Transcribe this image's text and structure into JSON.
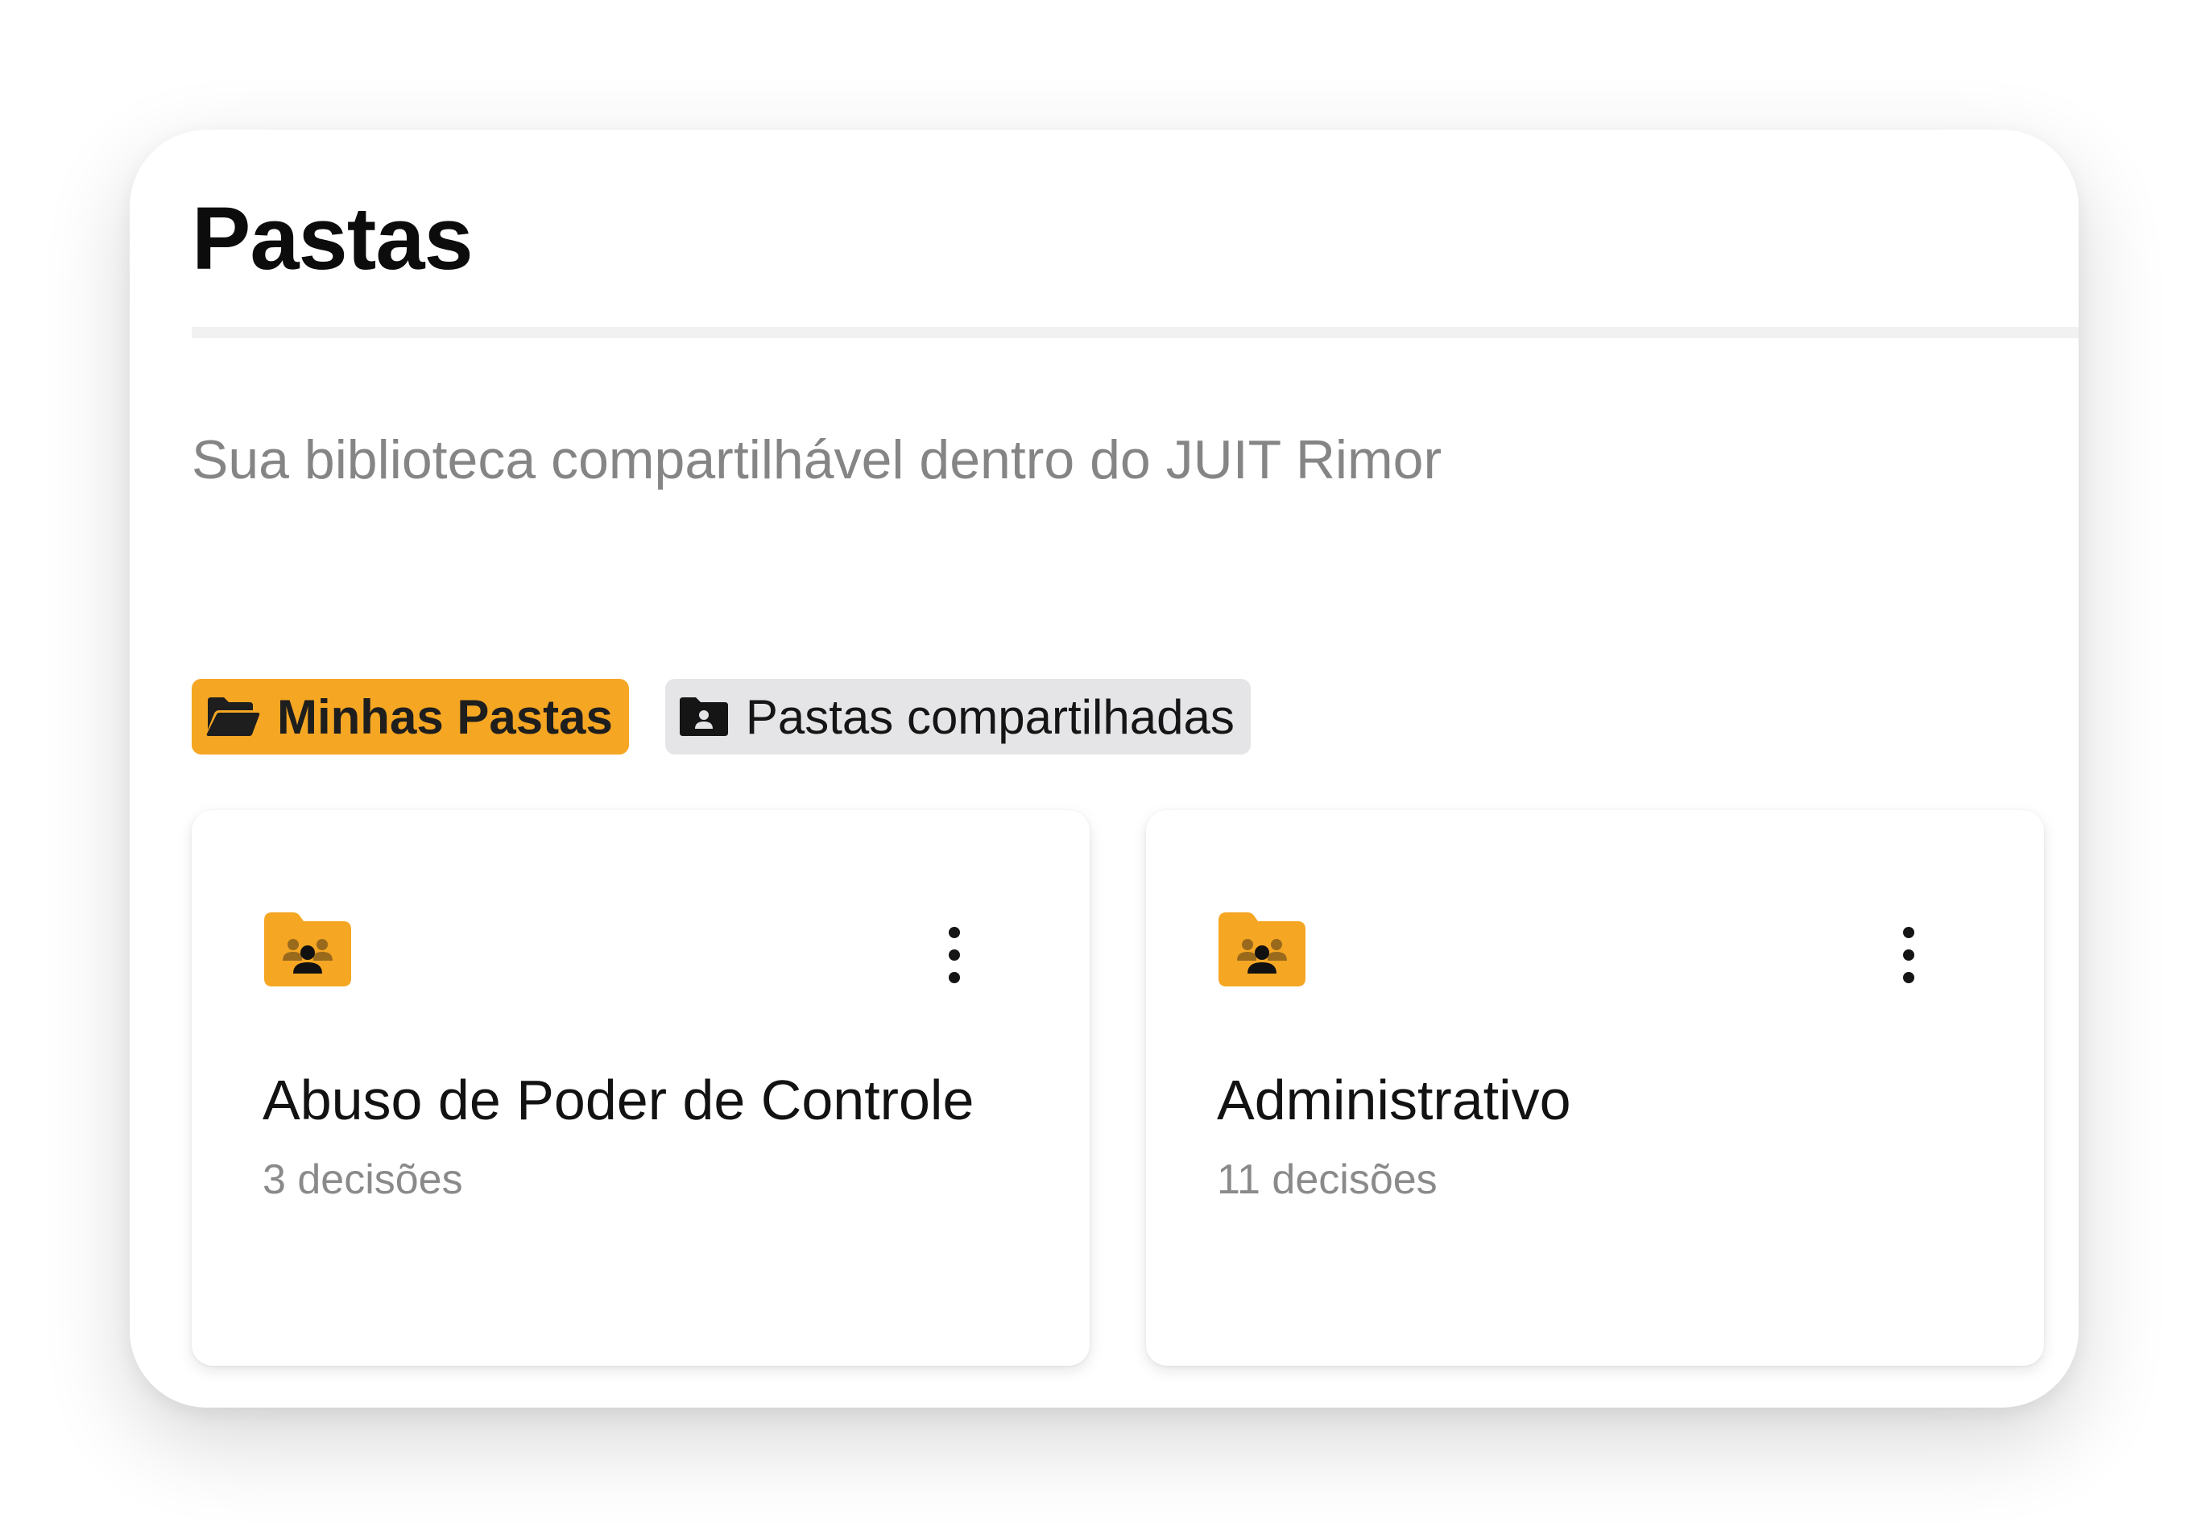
{
  "header": {
    "title": "Pastas",
    "subtitle": "Sua biblioteca compartilhável dentro do JUIT Rimor"
  },
  "tabs": [
    {
      "label": "Minhas Pastas",
      "icon": "folder-open-icon",
      "active": true
    },
    {
      "label": "Pastas compartilhadas",
      "icon": "folder-user-icon",
      "active": false
    }
  ],
  "folders": [
    {
      "name": "Abuso de Poder de Controle",
      "count": "3 decisões",
      "icon": "shared-folder-icon"
    },
    {
      "name": "Administrativo",
      "count": "11 decisões",
      "icon": "shared-folder-icon"
    }
  ],
  "colors": {
    "accent": "#f5a623",
    "inactive_tab": "#e5e5e7",
    "muted_text": "#858585"
  }
}
